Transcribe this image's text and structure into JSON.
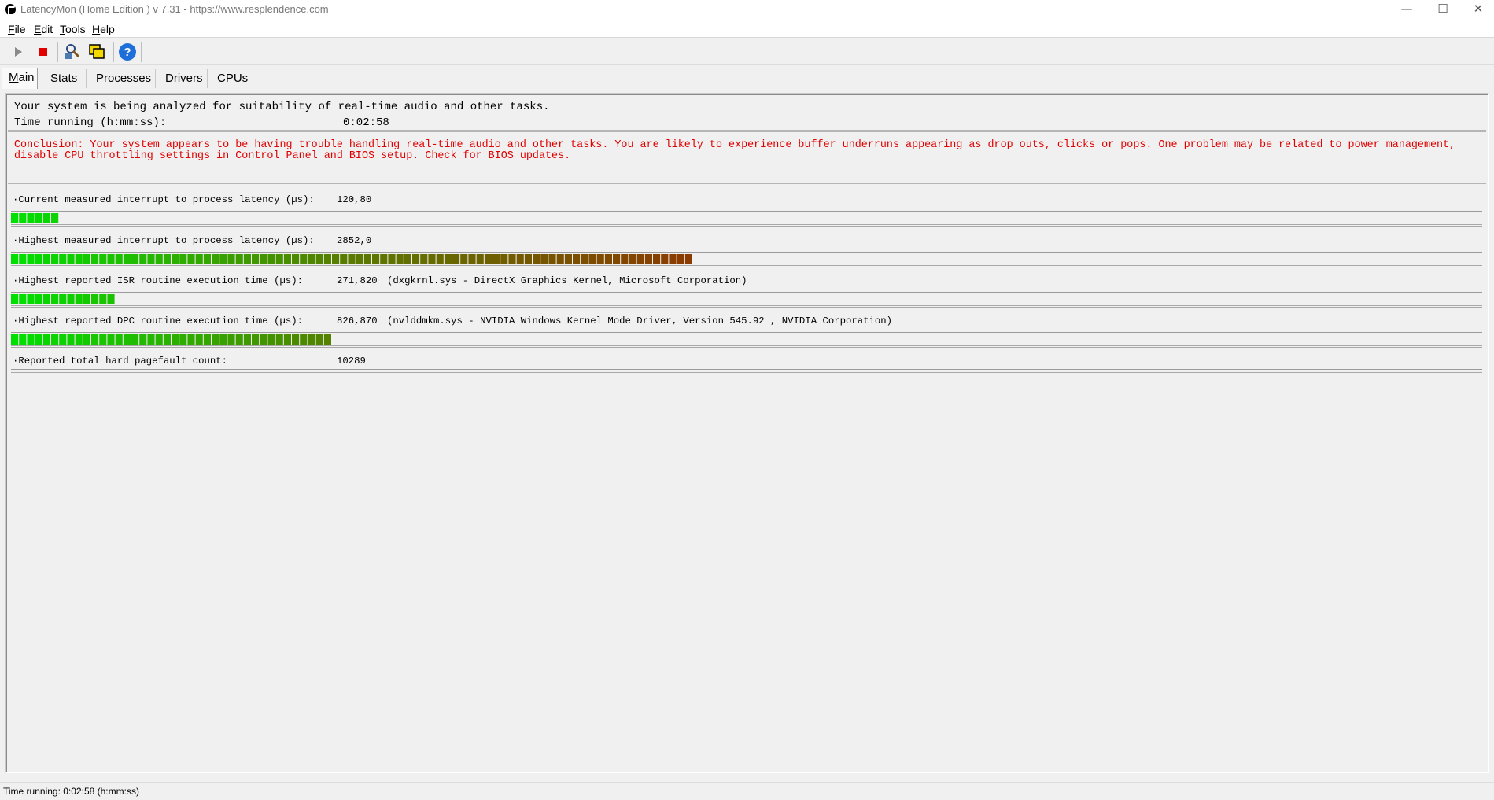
{
  "window": {
    "title": "LatencyMon  (Home Edition )  v 7.31 - https://www.resplendence.com",
    "minimize_glyph": "—",
    "maximize_glyph": "☐",
    "close_glyph": "✕"
  },
  "menu": {
    "items": [
      {
        "acc": "F",
        "rest": "ile"
      },
      {
        "acc": "E",
        "rest": "dit"
      },
      {
        "acc": "T",
        "rest": "ools"
      },
      {
        "acc": "H",
        "rest": "elp"
      }
    ]
  },
  "toolbar": {
    "icons": [
      "play-icon",
      "stop-icon",
      "search-tool-icon",
      "window-copy-icon",
      "help-icon"
    ],
    "colors": {
      "stop": "#e00000",
      "help": "#1e6fd9",
      "play": "#8a8a8a"
    }
  },
  "tabs": [
    {
      "acc": "M",
      "rest": "ain",
      "active": true
    },
    {
      "acc": "S",
      "rest": "tats",
      "active": false
    },
    {
      "acc": "P",
      "rest": "rocesses",
      "active": false
    },
    {
      "acc": "D",
      "rest": "rivers",
      "active": false
    },
    {
      "acc": "C",
      "rest": "PUs",
      "active": false
    }
  ],
  "analysis": {
    "message": "Your system is being analyzed for suitability of real-time audio and other tasks.",
    "time_label": "Time running (h:mm:ss):",
    "time_value": "0:02:58"
  },
  "conclusion": {
    "text": "Conclusion: Your system appears to be having trouble handling real-time audio and other tasks. You are likely to experience buffer underruns appearing as drop outs, clicks or pops. One problem may be related to power management, disable CPU throttling settings in Control Panel and BIOS setup. Check for BIOS updates.",
    "color": "#e00000"
  },
  "metrics": [
    {
      "label": "·Current measured interrupt to process latency (µs):",
      "value": "120,80",
      "extra": "",
      "bar_blocks": 6,
      "has_bar": true
    },
    {
      "label": "·Highest measured interrupt to process latency (µs):",
      "value": "2852,0",
      "extra": "",
      "bar_blocks": 85,
      "has_bar": true
    },
    {
      "label": "·Highest reported ISR routine execution time (µs):",
      "value": "271,820",
      "extra": "(dxgkrnl.sys - DirectX Graphics Kernel, Microsoft Corporation)",
      "bar_blocks": 13,
      "has_bar": true
    },
    {
      "label": "·Highest reported DPC routine execution time (µs):",
      "value": "826,870",
      "extra": "(nvlddmkm.sys - NVIDIA Windows Kernel Mode Driver, Version 545.92 , NVIDIA Corporation)",
      "bar_blocks": 40,
      "has_bar": true
    },
    {
      "label": "·Reported total hard pagefault count:",
      "value": "10289",
      "extra": "",
      "bar_blocks": 0,
      "has_bar": false
    }
  ],
  "meter_colors": {
    "green": "#00e000",
    "mid": "#5a7a00",
    "red": "#8b3a00"
  },
  "status": {
    "text": "Time running: 0:02:58  (h:mm:ss)"
  }
}
